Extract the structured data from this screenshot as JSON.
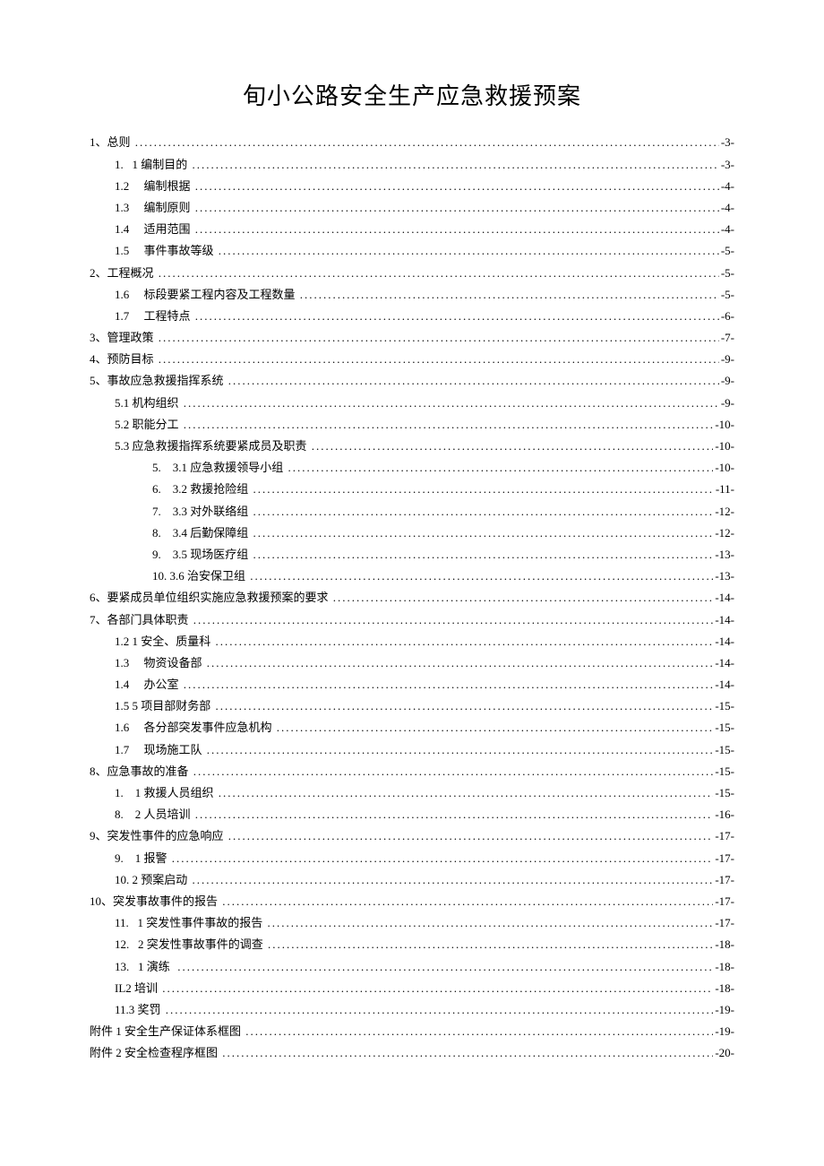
{
  "title": "旬小公路安全生产应急救援预案",
  "toc": [
    {
      "indent": 0,
      "label": "1、总则 ",
      "page": "-3-"
    },
    {
      "indent": 1,
      "label": "1.   1 编制目的 ",
      "page": "-3-"
    },
    {
      "indent": 1,
      "label": "1.2     编制根据 ",
      "page": "-4-"
    },
    {
      "indent": 1,
      "label": "1.3     编制原则 ",
      "page": "-4-"
    },
    {
      "indent": 1,
      "label": "1.4     适用范围 ",
      "page": "-4-"
    },
    {
      "indent": 1,
      "label": "1.5     事件事故等级 ",
      "page": "-5-"
    },
    {
      "indent": 0,
      "label": "2、工程概况 ",
      "page": "-5-"
    },
    {
      "indent": 1,
      "label": "1.6     标段要紧工程内容及工程数量 ",
      "page": "-5-"
    },
    {
      "indent": 1,
      "label": "1.7     工程特点 ",
      "page": "-6-"
    },
    {
      "indent": 0,
      "label": "3、管理政策 ",
      "page": "-7-"
    },
    {
      "indent": 0,
      "label": "4、预防目标 ",
      "page": "-9-"
    },
    {
      "indent": 0,
      "label": "5、事故应急救援指挥系统 ",
      "page": "-9-"
    },
    {
      "indent": 1,
      "label": "5.1 机构组织 ",
      "page": "-9-"
    },
    {
      "indent": 1,
      "label": "5.2 职能分工 ",
      "page": "-10-"
    },
    {
      "indent": 1,
      "label": "5.3 应急救援指挥系统要紧成员及职责 ",
      "page": "-10-"
    },
    {
      "indent": 2,
      "label": "5.    3.1 应急救援领导小组 ",
      "page": "-10-"
    },
    {
      "indent": 2,
      "label": "6.    3.2 救援抢险组 ",
      "page": "-11-"
    },
    {
      "indent": 2,
      "label": "7.    3.3 对外联络组 ",
      "page": "-12-"
    },
    {
      "indent": 2,
      "label": "8.    3.4 后勤保障组 ",
      "page": "-12-"
    },
    {
      "indent": 2,
      "label": "9.    3.5 现场医疗组 ",
      "page": "-13-"
    },
    {
      "indent": 2,
      "label": "10. 3.6 治安保卫组 ",
      "page": "-13-"
    },
    {
      "indent": 0,
      "label": "6、要紧成员单位组织实施应急救援预案的要求 ",
      "page": "-14-"
    },
    {
      "indent": 0,
      "label": "7、各部门具体职责 ",
      "page": "-14-"
    },
    {
      "indent": 1,
      "label": "1.2 1 安全、质量科 ",
      "page": "-14-"
    },
    {
      "indent": 1,
      "label": "1.3     物资设备部 ",
      "page": "-14-"
    },
    {
      "indent": 1,
      "label": "1.4     办公室 ",
      "page": "-14-"
    },
    {
      "indent": 1,
      "label": "1.5 5 项目部财务部 ",
      "page": "-15-"
    },
    {
      "indent": 1,
      "label": "1.6     各分部突发事件应急机构 ",
      "page": "-15-"
    },
    {
      "indent": 1,
      "label": "1.7     现场施工队 ",
      "page": "-15-"
    },
    {
      "indent": 0,
      "label": "8、应急事故的准备 ",
      "page": "-15-"
    },
    {
      "indent": 1,
      "label": "1.    1 救援人员组织 ",
      "page": "-15-"
    },
    {
      "indent": 1,
      "label": "8.    2 人员培训 ",
      "page": "-16-"
    },
    {
      "indent": 0,
      "label": "9、突发性事件的应急响应 ",
      "page": "-17-"
    },
    {
      "indent": 1,
      "label": "9.    1 报警 ",
      "page": "-17-"
    },
    {
      "indent": 1,
      "label": "10. 2 预案启动 ",
      "page": "-17-"
    },
    {
      "indent": 0,
      "label": "10、突发事故事件的报告 ",
      "page": "-17-"
    },
    {
      "indent": 1,
      "label": "11.   1 突发性事件事故的报告 ",
      "page": "-17-"
    },
    {
      "indent": 1,
      "label": "12.   2 突发性事故事件的调查 ",
      "page": "-18-"
    },
    {
      "indent": 1,
      "label": "13.   1 演练  ",
      "page": "-18-"
    },
    {
      "indent": 1,
      "label": "IL2 培训 ",
      "page": "-18-"
    },
    {
      "indent": 1,
      "label": "11.3 奖罚 ",
      "page": "-19-"
    },
    {
      "indent": 0,
      "label": "附件 1 安全生产保证体系框图 ",
      "page": "-19-"
    },
    {
      "indent": 0,
      "label": "附件 2 安全检查程序框图 ",
      "page": "-20-"
    }
  ]
}
